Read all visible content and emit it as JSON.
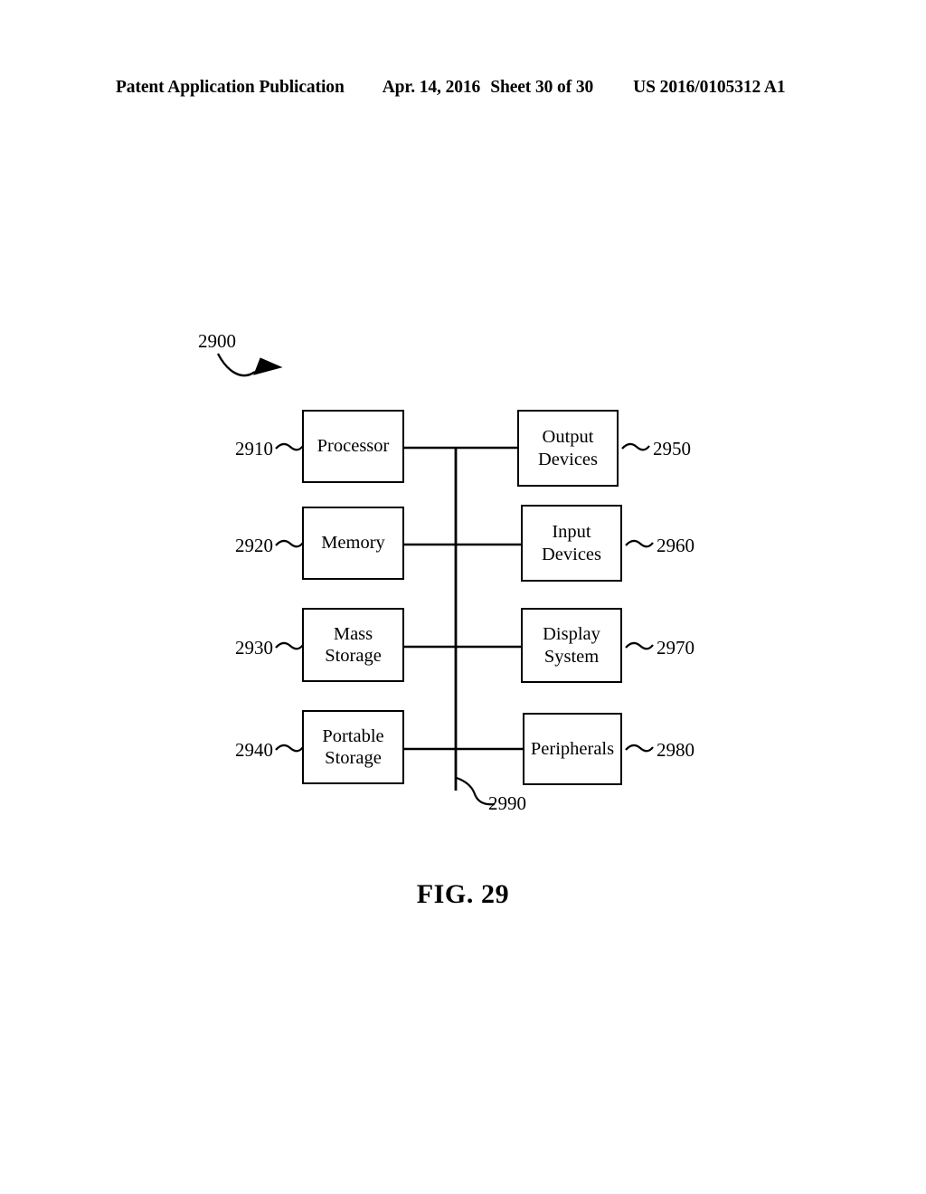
{
  "header": {
    "publication": "Patent Application Publication",
    "date": "Apr. 14, 2016",
    "sheet": "Sheet 30 of 30",
    "patent_number": "US 2016/0105312 A1"
  },
  "figure": {
    "caption": "FIG. 29",
    "system_label": "2900",
    "bus_label": "2990",
    "left_column": [
      {
        "label": "Processor",
        "ref": "2910"
      },
      {
        "label": "Memory",
        "ref": "2920"
      },
      {
        "label": "Mass\nStorage",
        "ref": "2930"
      },
      {
        "label": "Portable\nStorage",
        "ref": "2940"
      }
    ],
    "right_column": [
      {
        "label": "Output\nDevices",
        "ref": "2950"
      },
      {
        "label": "Input\nDevices",
        "ref": "2960"
      },
      {
        "label": "Display\nSystem",
        "ref": "2970"
      },
      {
        "label": "Peripherals",
        "ref": "2980"
      }
    ],
    "nodes": {
      "processor": "Processor",
      "memory": "Memory",
      "mass_storage_1": "Mass",
      "mass_storage_2": "Storage",
      "portable_storage_1": "Portable",
      "portable_storage_2": "Storage",
      "output_devices_1": "Output",
      "output_devices_2": "Devices",
      "input_devices_1": "Input",
      "input_devices_2": "Devices",
      "display_system_1": "Display",
      "display_system_2": "System",
      "peripherals": "Peripherals"
    },
    "refs": {
      "processor": "2910",
      "memory": "2920",
      "mass_storage": "2930",
      "portable_storage": "2940",
      "output_devices": "2950",
      "input_devices": "2960",
      "display_system": "2970",
      "peripherals": "2980",
      "system": "2900",
      "bus": "2990"
    },
    "colors": {
      "ink": "#000000",
      "paper": "#ffffff"
    }
  }
}
